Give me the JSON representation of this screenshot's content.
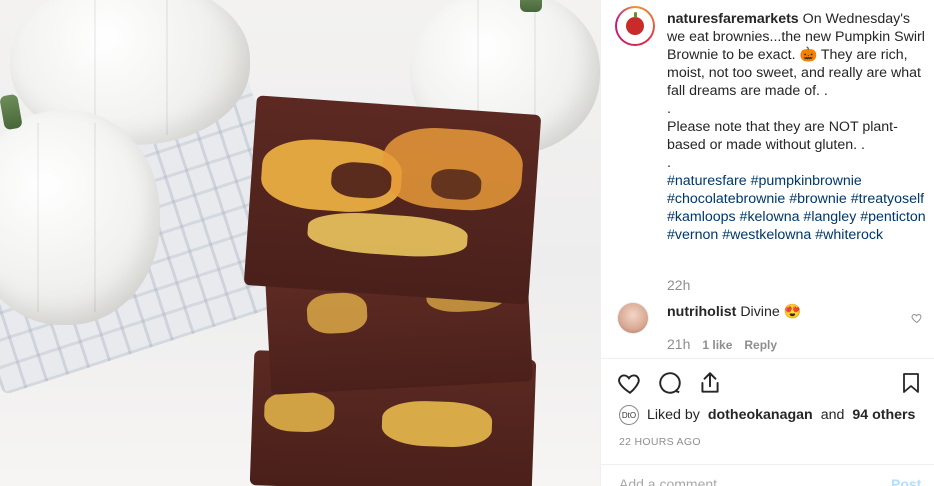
{
  "post": {
    "username": "naturesfaremarkets",
    "caption_text": "On Wednesday's we eat brownies...the new Pumpkin Swirl Brownie to be exact. 🎃 They are rich, moist, not too sweet, and really are what fall dreams are made of. .\n.\nPlease note that they are NOT plant-based or made without gluten. .\n.",
    "hashtags": "#naturesfare #pumpkinbrownie #chocolatebrownie #brownie #treatyoself #kamloops #kelowna #langley #penticton #vernon #westkelowna #whiterock",
    "caption_time": "22h"
  },
  "comment": {
    "username": "nutriholist",
    "text": "Divine 😍",
    "time": "21h",
    "likes": "1 like",
    "reply_label": "Reply"
  },
  "likes": {
    "prefix": "Liked by",
    "user": "dotheokanagan",
    "joiner": "and",
    "others": "94 others"
  },
  "timestamp": "22 HOURS AGO",
  "add_comment_placeholder": "Add a comment...",
  "post_button_label": "Post",
  "icons": {
    "like": "heart-icon",
    "comment": "comment-icon",
    "share": "share-icon",
    "save": "bookmark-icon",
    "comment_like": "small-heart-icon"
  },
  "colors": {
    "hashtag": "#00376b",
    "muted": "#8e8e8e",
    "text": "#262626"
  }
}
